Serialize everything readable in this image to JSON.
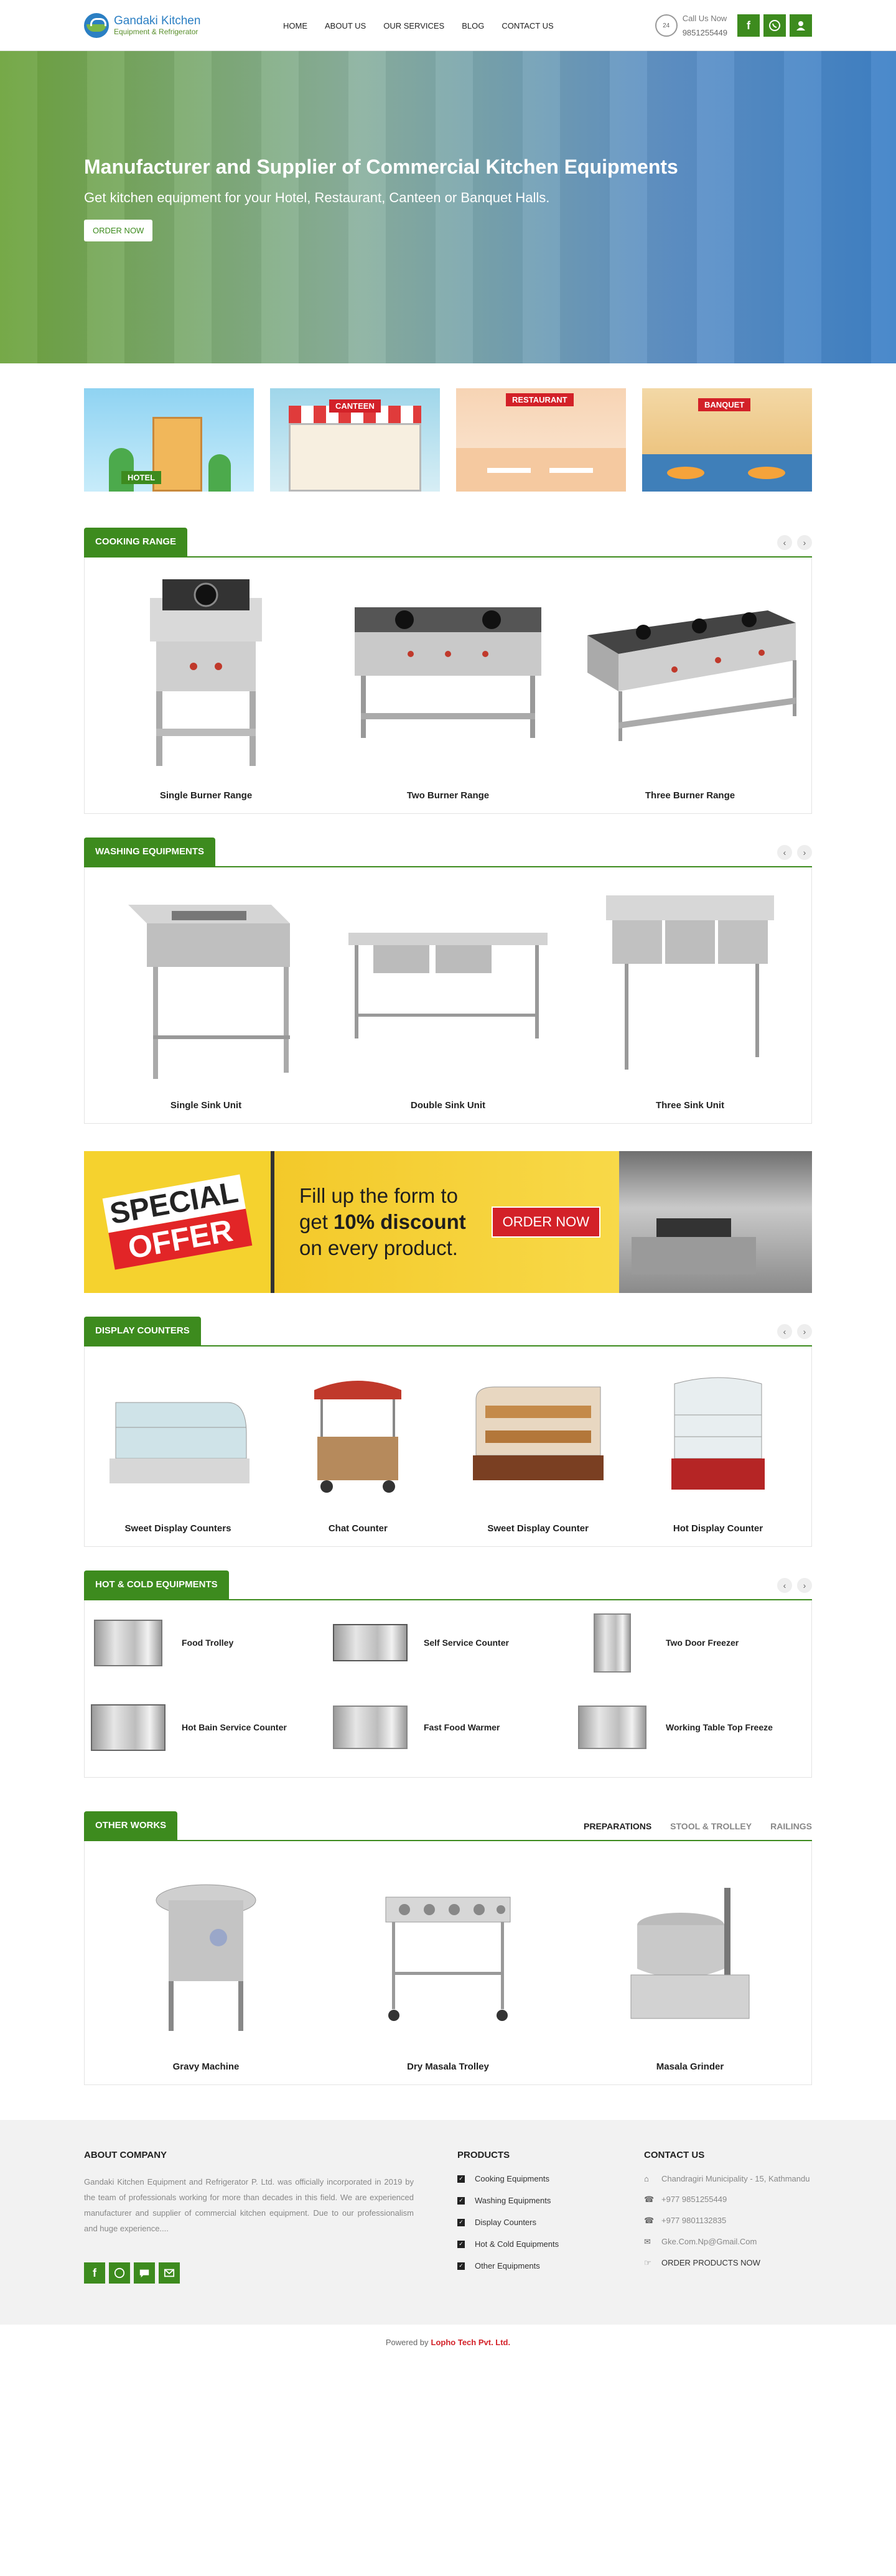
{
  "header": {
    "logo_line1": "Gandaki Kitchen",
    "logo_line2": "Equipment & Refrigerator",
    "nav": [
      "HOME",
      "ABOUT US",
      "OUR SERVICES",
      "BLOG",
      "CONTACT US"
    ],
    "call_label": "Call Us Now",
    "call_number": "9851255449",
    "call_icon_text": "24",
    "icons": [
      "facebook-icon",
      "whatsapp-icon",
      "user-icon"
    ]
  },
  "hero": {
    "title": "Manufacturer and Supplier of Commercial Kitchen Equipments",
    "subtitle": "Get kitchen equipment for your Hotel, Restaurant, Canteen or Banquet Halls.",
    "button": "ORDER NOW"
  },
  "categories": [
    {
      "label": "HOTEL"
    },
    {
      "label": "CANTEEN"
    },
    {
      "label": "RESTAURANT"
    },
    {
      "label": "BANQUET"
    }
  ],
  "cooking": {
    "title": "COOKING RANGE",
    "items": [
      "Single Burner Range",
      "Two Burner Range",
      "Three Burner Range"
    ]
  },
  "washing": {
    "title": "WASHING EQUIPMENTS",
    "items": [
      "Single Sink Unit",
      "Double Sink Unit",
      "Three Sink Unit"
    ]
  },
  "banner": {
    "special": "SPECIAL",
    "offer": "OFFER",
    "line1": "Fill up the form to",
    "line2a": "get ",
    "line2b": "10% discount",
    "line3": "on every product.",
    "button": "ORDER NOW"
  },
  "display": {
    "title": "DISPLAY COUNTERS",
    "items": [
      "Sweet Display Counters",
      "Chat Counter",
      "Sweet Display Counter",
      "Hot Display Counter"
    ]
  },
  "hotcold": {
    "title": "HOT & COLD EQUIPMENTS",
    "items": [
      "Food Trolley",
      "Self Service Counter",
      "Two Door Freezer",
      "Hot Bain Service Counter",
      "Fast Food Warmer",
      "Working Table Top Freeze"
    ]
  },
  "other": {
    "title": "OTHER WORKS",
    "tabs": [
      "PREPARATIONS",
      "STOOL & TROLLEY",
      "RAILINGS"
    ],
    "items": [
      "Gravy Machine",
      "Dry Masala Trolley",
      "Masala Grinder"
    ]
  },
  "footer": {
    "about_title": "ABOUT COMPANY",
    "about_text": "Gandaki Kitchen Equipment and Refrigerator P. Ltd. was officially incorporated in 2019 by the team of professionals working for more than decades in this field. We are experienced manufacturer and supplier of commercial kitchen equipment. Due to our professionalism and huge experience....",
    "products_title": "PRODUCTS",
    "products": [
      "Cooking Equipments",
      "Washing Equipments",
      "Display Counters",
      "Hot & Cold Equipments",
      "Other Equipments"
    ],
    "contact_title": "CONTACT US",
    "address": "Chandragiri Municipality - 15, Kathmandu",
    "phone1": "+977 9851255449",
    "phone2": "+977 9801132835",
    "email": "Gke.Com.Np@Gmail.Com",
    "order_link": "ORDER PRODUCTS NOW",
    "powered_prefix": "Powered by",
    "powered_by": "Lopho Tech Pvt. Ltd."
  },
  "colors": {
    "brand_green": "#3d8b1e",
    "brand_blue": "#2b7fc3",
    "accent_red": "#d32128",
    "offer_yellow": "#f5d22e"
  }
}
